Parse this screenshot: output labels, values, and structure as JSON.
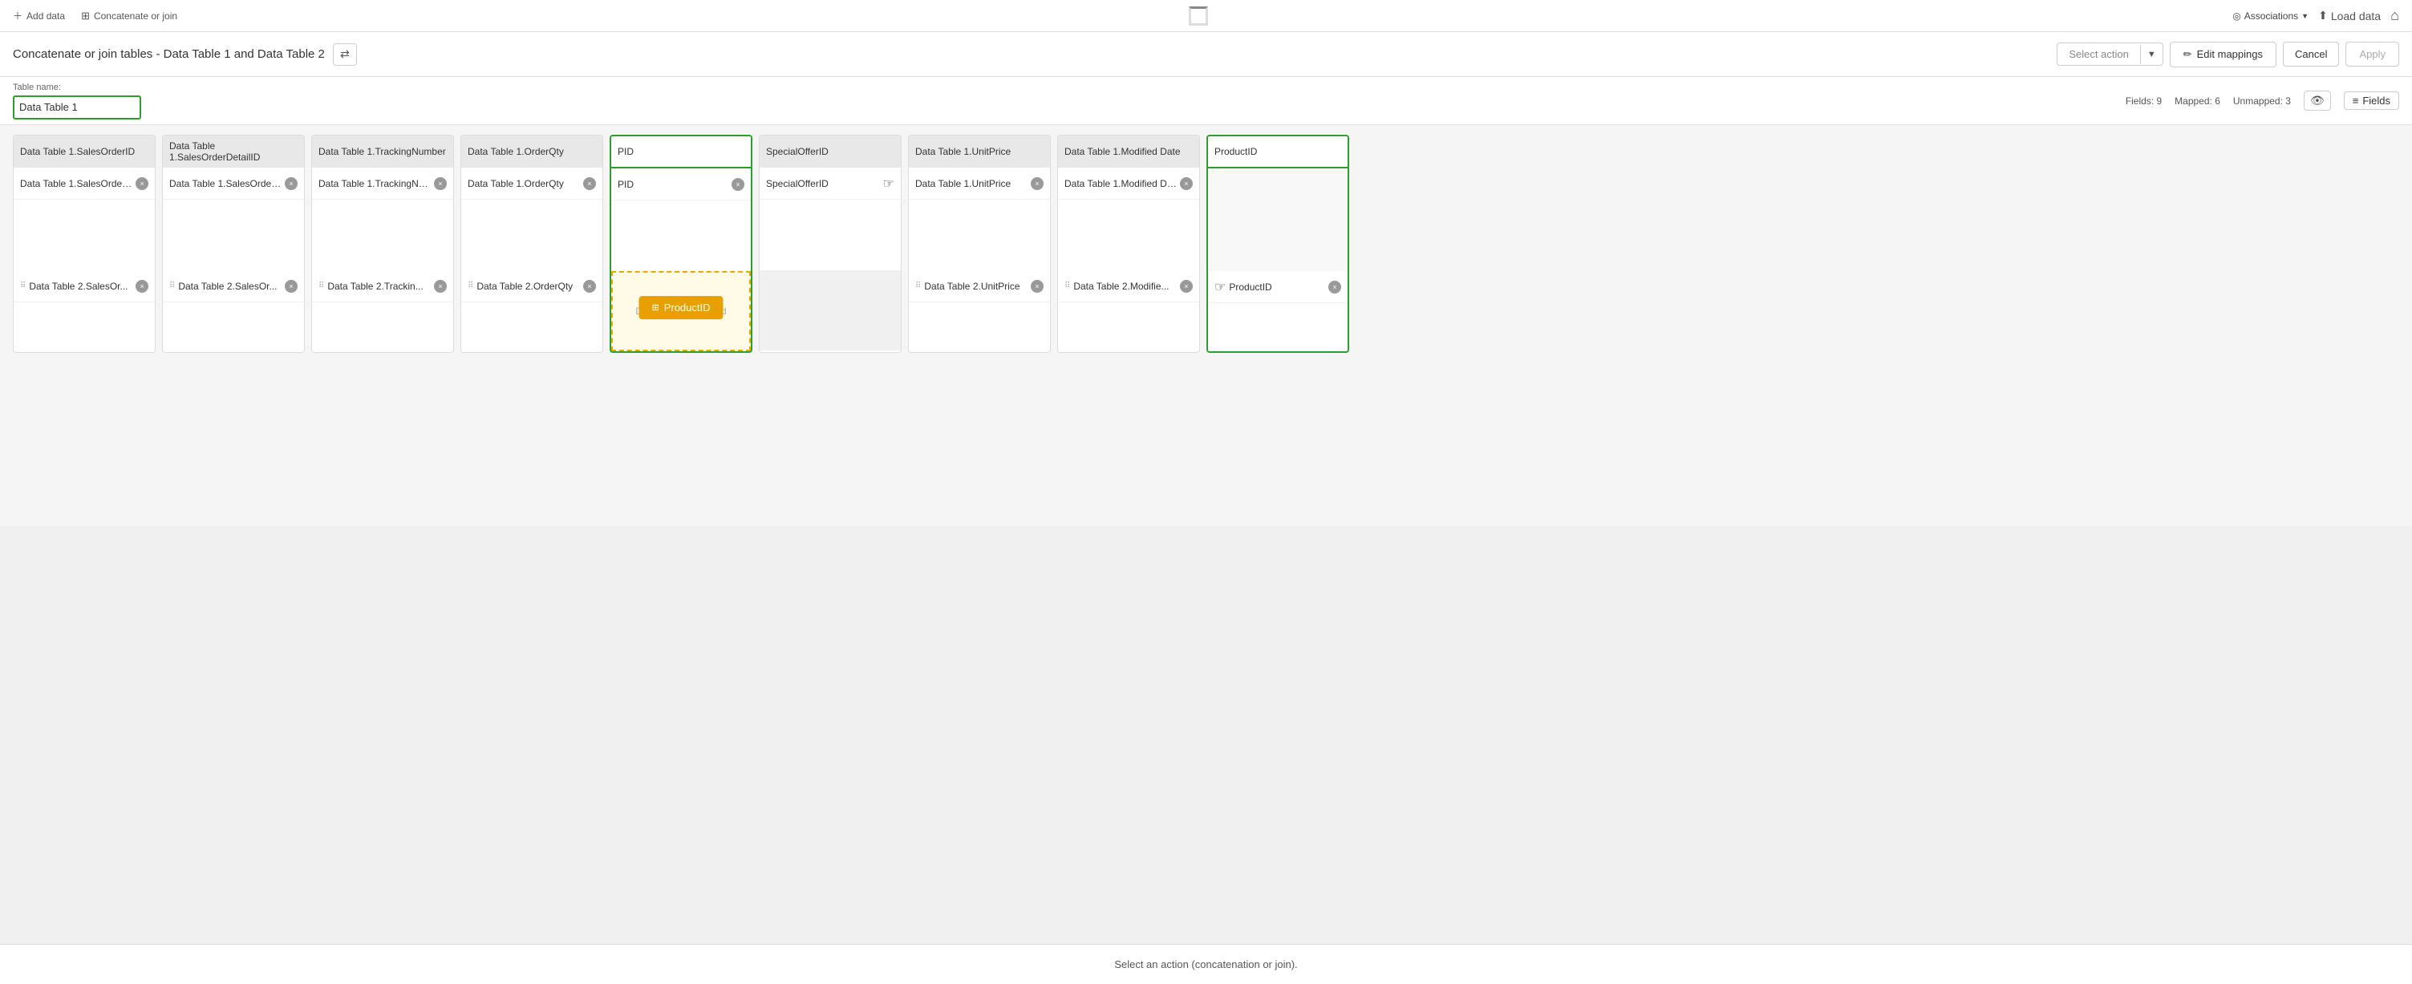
{
  "topNav": {
    "addDataLabel": "Add data",
    "concatJoinLabel": "Concatenate or join",
    "associationsLabel": "Associations",
    "loadDataLabel": "Load data",
    "homeIcon": "⌂"
  },
  "header": {
    "title": "Concatenate or join tables - Data Table 1 and Data Table 2",
    "swapIcon": "⇄",
    "selectActionPlaceholder": "Select action",
    "editMappingsLabel": "Edit mappings",
    "cancelLabel": "Cancel",
    "applyLabel": "Apply"
  },
  "tableNameRow": {
    "label": "Table name:",
    "value": "Data Table 1",
    "fieldsCount": "Fields: 9",
    "mappedCount": "Mapped: 6",
    "unmappedCount": "Unmapped: 3",
    "fieldsLabel": "Fields"
  },
  "columns": [
    {
      "id": "salesOrderID",
      "header": "Data Table 1.SalesOrderID",
      "highlighted": false,
      "topField": "Data Table 1.SalesOrderID",
      "bottomField": "Data Table 2.SalesOr...",
      "bottomDrag": false
    },
    {
      "id": "salesOrderDetailID",
      "header": "Data Table 1.SalesOrderDetailID",
      "highlighted": false,
      "topField": "Data Table 1.SalesOrder...",
      "bottomField": "Data Table 2.SalesOr...",
      "bottomDrag": false
    },
    {
      "id": "trackingNumber",
      "header": "Data Table 1.TrackingNumber",
      "highlighted": false,
      "topField": "Data Table 1.TrackingNu...",
      "bottomField": "Data Table 2.Trackin...",
      "bottomDrag": false
    },
    {
      "id": "orderQty",
      "header": "Data Table 1.OrderQty",
      "highlighted": false,
      "topField": "Data Table 1.OrderQty",
      "bottomField": "Data Table 2.OrderQty",
      "bottomDrag": false
    },
    {
      "id": "pid",
      "header": "PID",
      "highlighted": true,
      "topField": "PID",
      "bottomField": null,
      "bottomDrag": true,
      "dragPillLabel": "ProductID",
      "dropZoneText": "Drop to map this field"
    },
    {
      "id": "specialOfferID",
      "header": "SpecialOfferID",
      "highlighted": false,
      "topField": "SpecialOfferID",
      "bottomField": null,
      "bottomEmpty": true,
      "hasHandCursor": true
    },
    {
      "id": "unitPrice",
      "header": "Data Table 1.UnitPrice",
      "highlighted": false,
      "topField": "Data Table 1.UnitPrice",
      "bottomField": "Data Table 2.UnitPrice",
      "bottomDrag": false
    },
    {
      "id": "modifiedDate",
      "header": "Data Table 1.Modified Date",
      "highlighted": false,
      "topField": "Data Table 1.Modified Date",
      "bottomField": "Data Table 2.Modifie...",
      "bottomDrag": false
    },
    {
      "id": "productID",
      "header": "ProductID",
      "highlighted": true,
      "topField": null,
      "topEmpty": true,
      "bottomField": "ProductID",
      "bottomDrag": false,
      "hasHandCursor": true
    }
  ],
  "statusBar": {
    "text": "Select an action (concatenation or join)."
  }
}
